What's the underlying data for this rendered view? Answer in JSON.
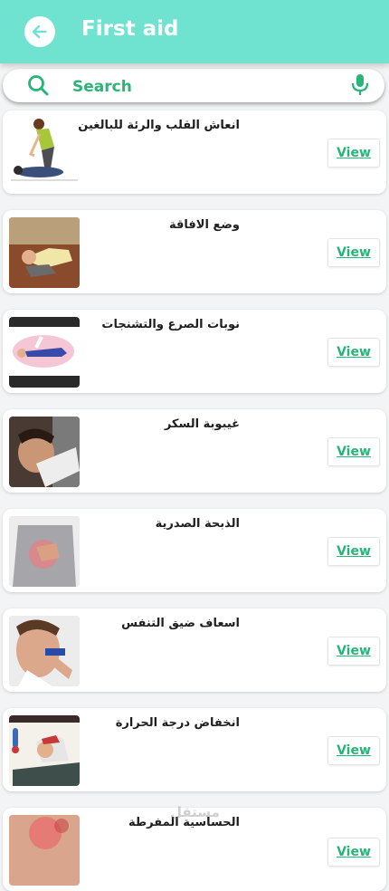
{
  "header": {
    "title": "First aid",
    "back_icon": "arrow-left-icon",
    "background_color": "#6fe3cf"
  },
  "search": {
    "placeholder": "Search",
    "search_icon": "search-icon",
    "mic_icon": "microphone-icon",
    "accent_color": "#29b478"
  },
  "items": [
    {
      "title": "انعاش القلب والرئة للبالغين",
      "button": "View",
      "image": "cpr-illustration"
    },
    {
      "title": "وضع الافاقة",
      "button": "View",
      "image": "recovery-position-photo"
    },
    {
      "title": "نوبات الصرع والتشنجات",
      "button": "View",
      "image": "seizure-illustration"
    },
    {
      "title": "غيبوبة السكر",
      "button": "View",
      "image": "diabetic-coma-photo"
    },
    {
      "title": "الذبحة الصدرية",
      "button": "View",
      "image": "chest-pain-photo"
    },
    {
      "title": "اسعاف ضيق التنفس",
      "button": "View",
      "image": "inhaler-photo"
    },
    {
      "title": "انخفاض درجة الحرارة",
      "button": "View",
      "image": "hypothermia-illustration"
    },
    {
      "title": "الحساسية المفرطة",
      "button": "View",
      "image": "allergy-photo"
    }
  ],
  "watermark": "مستقل"
}
